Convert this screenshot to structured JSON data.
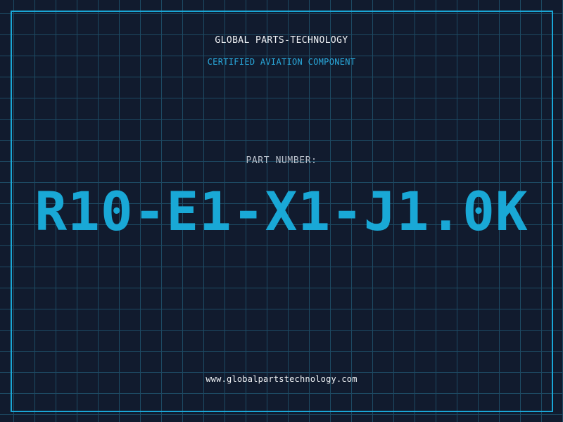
{
  "header": {
    "company": "GLOBAL PARTS-TECHNOLOGY",
    "subtitle": "CERTIFIED AVIATION COMPONENT"
  },
  "part": {
    "label": "PART NUMBER:",
    "number": "R10-E1-X1-J1.0K"
  },
  "footer": {
    "website": "www.globalpartstechnology.com"
  },
  "colors": {
    "background": "#111b2e",
    "grid": "#1d4a63",
    "accent": "#19a8d6",
    "text": "#f0f2f5"
  }
}
